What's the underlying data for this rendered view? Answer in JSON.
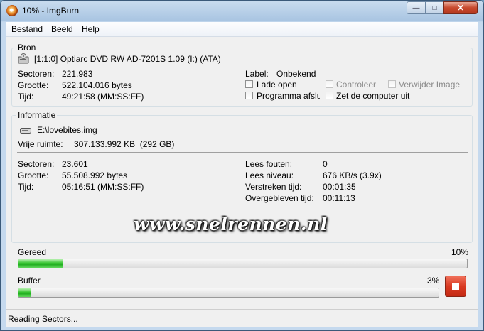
{
  "window": {
    "title": "10% - ImgBurn"
  },
  "menu": [
    "Bestand",
    "Beeld",
    "Help"
  ],
  "bron": {
    "heading": "Bron",
    "device": "[1:1:0] Optiarc DVD RW AD-7201S 1.09 (I:) (ATA)",
    "sectors_label": "Sectoren:",
    "sectors_value": "221.983",
    "size_label": "Grootte:",
    "size_value": "522.104.016 bytes",
    "time_label": "Tijd:",
    "time_value": "49:21:58 (MM:SS:FF)",
    "label_label": "Label:",
    "label_value": "Onbekend",
    "opt_eject": "Lade open",
    "opt_verify": "Controleer",
    "opt_delete_image": "Verwijder Image",
    "opt_close_program": "Programma afslu",
    "opt_shutdown": "Zet de computer uit"
  },
  "info": {
    "heading": "Informatie",
    "file": "E:\\lovebites.img",
    "free_label": "Vrije ruimte:",
    "free_value": "307.133.992 KB  (292 GB)",
    "sectors_label": "Sectoren:",
    "sectors_value": "23.601",
    "size_label": "Grootte:",
    "size_value": "55.508.992 bytes",
    "time_label": "Tijd:",
    "time_value": "05:16:51 (MM:SS:FF)",
    "read_errors_label": "Lees fouten:",
    "read_errors_value": "0",
    "read_level_label": "Lees niveau:",
    "read_level_value": "676 KB/s (3.9x)",
    "elapsed_label": "Verstreken tijd:",
    "elapsed_value": "00:01:35",
    "remaining_label": "Overgebleven tijd:",
    "remaining_value": "00:11:13"
  },
  "watermark": "www.snelrennen.nl",
  "progress": {
    "label": "Gereed",
    "percent_text": "10%",
    "percent": 10
  },
  "buffer": {
    "label": "Buffer",
    "percent_text": "3%",
    "percent": 3
  },
  "status": "Reading Sectors...",
  "icons": {
    "app": "imgburn-disc-icon",
    "drive": "optical-drive-icon",
    "file": "disc-image-icon",
    "stop": "stop-icon"
  },
  "colors": {
    "progress_fill": "#37c431",
    "stop_button": "#d93a22"
  }
}
